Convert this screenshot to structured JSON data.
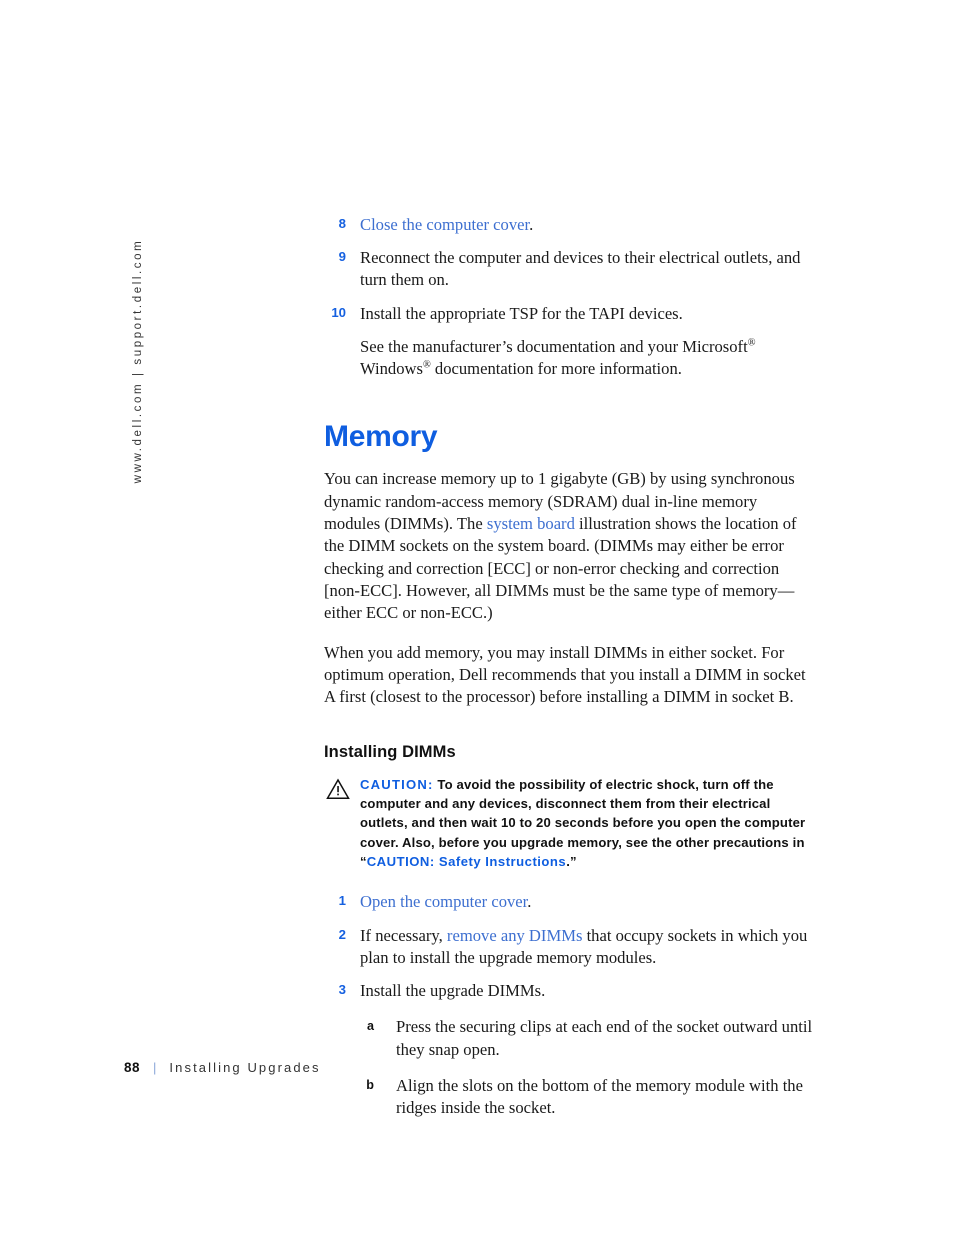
{
  "page": {
    "side_rail_text": "www.dell.com | support.dell.com",
    "background_color": "#ffffff",
    "link_color": "#3d6fd0",
    "heading_color": "#0f5ee0",
    "step_number_color": "#1560e0"
  },
  "continued_steps": {
    "items": [
      {
        "number": "8",
        "link_text": "Close the computer cover",
        "after_link": ".",
        "is_link": true
      },
      {
        "number": "9",
        "text": "Reconnect the computer and devices to their electrical outlets, and turn them on.",
        "is_link": false
      },
      {
        "number": "10",
        "text": "Install the appropriate TSP for the TAPI devices.",
        "is_link": false,
        "continuation_pre": "See the manufacturer’s documentation and your Microsoft",
        "continuation_reg1": "®",
        "continuation_mid": " Windows",
        "continuation_reg2": "®",
        "continuation_post": " documentation for more information."
      }
    ]
  },
  "memory_section": {
    "title": "Memory",
    "paragraph1_part1": "You can increase memory up to 1 gigabyte (GB) by using synchronous dynamic random-access memory (SDRAM) dual in-line memory modules (DIMMs). The ",
    "paragraph1_link": "system board",
    "paragraph1_part2": " illustration shows the location of the DIMM sockets on the system board. (DIMMs may either be error checking and correction [ECC] or non-error checking and correction [non-ECC]. However, all DIMMs must be the same type of memory—either ECC or non-ECC.)",
    "paragraph2": "When you add memory, you may install DIMMs in either socket. For optimum operation, Dell recommends that you install a DIMM in socket A first (closest to the processor) before installing a DIMM in socket B."
  },
  "installing_dimms": {
    "title": "Installing DIMMs",
    "caution": {
      "icon": "warning-triangle-icon",
      "label": "CAUTION:",
      "text_part1": " To avoid the possibility of electric shock, turn off the computer and any devices, disconnect them from their electrical outlets, and then wait 10 to 20 seconds before you open the computer cover. Also, before you upgrade memory, see the other precautions in “",
      "link_text": "CAUTION: Safety Instructions",
      "text_part2": ".”"
    },
    "steps": [
      {
        "number": "1",
        "link_text": "Open the computer cover",
        "after_link": ".",
        "is_link": true
      },
      {
        "number": "2",
        "pre_link": "If necessary, ",
        "link_text": "remove any DIMMs",
        "post_link": " that occupy sockets in which you plan to install the upgrade memory modules.",
        "is_link": true
      },
      {
        "number": "3",
        "text": "Install the upgrade DIMMs.",
        "is_link": false,
        "substeps": [
          {
            "letter": "a",
            "text": "Press the securing clips at each end of the socket outward until they snap open."
          },
          {
            "letter": "b",
            "text": "Align the slots on the bottom of the memory module with the ridges inside the socket."
          }
        ]
      }
    ]
  },
  "footer": {
    "page_number": "88",
    "separator": "|",
    "chapter_label": "Installing Upgrades"
  }
}
